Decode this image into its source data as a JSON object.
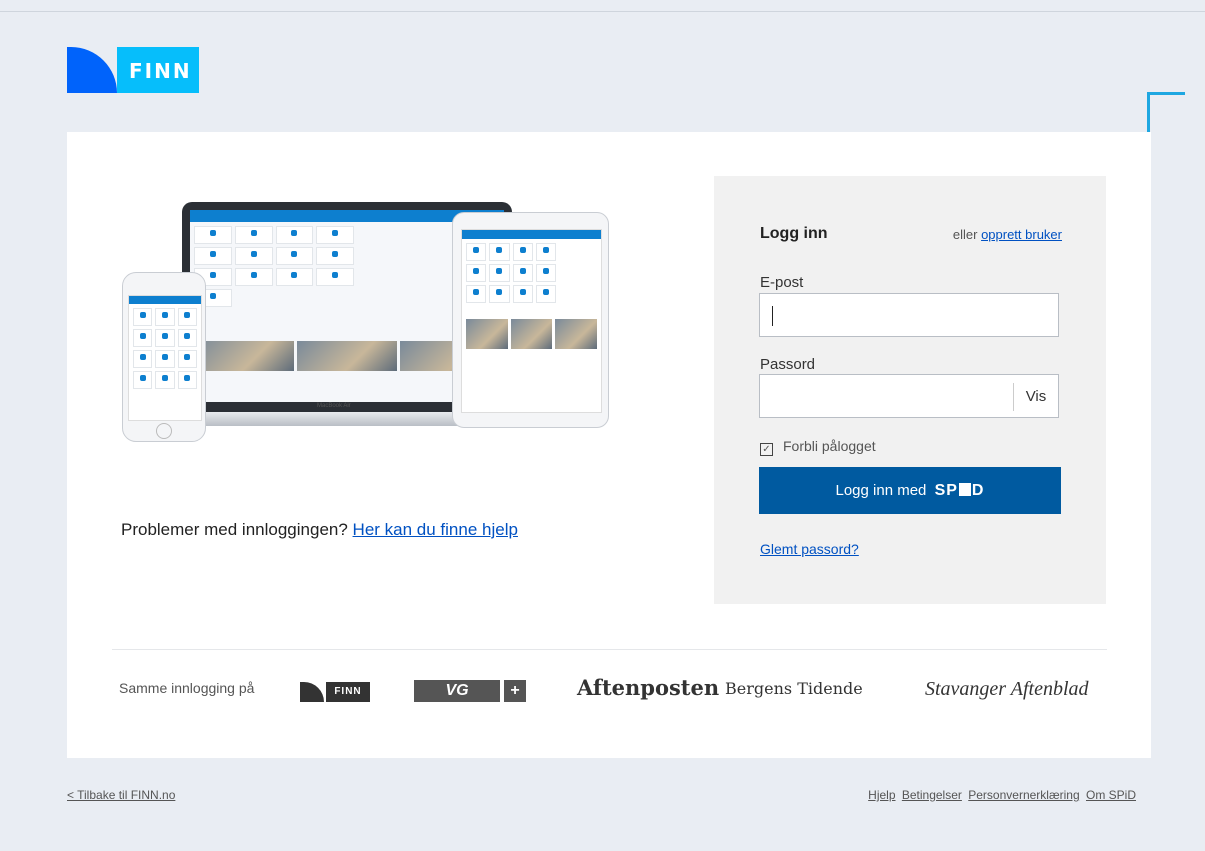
{
  "brand": {
    "logo_text": "FINN"
  },
  "illustration": {
    "laptop_label": "MacBook Air"
  },
  "help": {
    "prefix": "Problemer med innloggingen?",
    "link": "Her kan du finne hjelp"
  },
  "login": {
    "title": "Logg inn",
    "or_text": "eller",
    "create_link": "opprett bruker",
    "email_label": "E-post",
    "email_value": "",
    "password_label": "Passord",
    "password_value": "",
    "show_button": "Vis",
    "remember_label": "Forbli pålogget",
    "remember_checked": true,
    "submit_prefix": "Logg inn med",
    "submit_brand_a": "SP",
    "submit_brand_b": "D",
    "forgot_link": "Glemt passord?"
  },
  "partners": {
    "intro": "Samme innlogging på",
    "finn": "FINN",
    "vg": "VG",
    "aftenposten": "Aftenposten",
    "bt": "Bergens Tidende",
    "sa": "Stavanger Aftenblad"
  },
  "footer": {
    "back": "< Tilbake til FINN.no",
    "links": [
      "Hjelp",
      "Betingelser",
      "Personvernerklæring",
      "Om SPiD"
    ]
  },
  "colors": {
    "primary_button": "#005aa0",
    "finn_dark": "#0063fb",
    "finn_light": "#06befb",
    "annotation_arrow": "#1ea7e1"
  }
}
